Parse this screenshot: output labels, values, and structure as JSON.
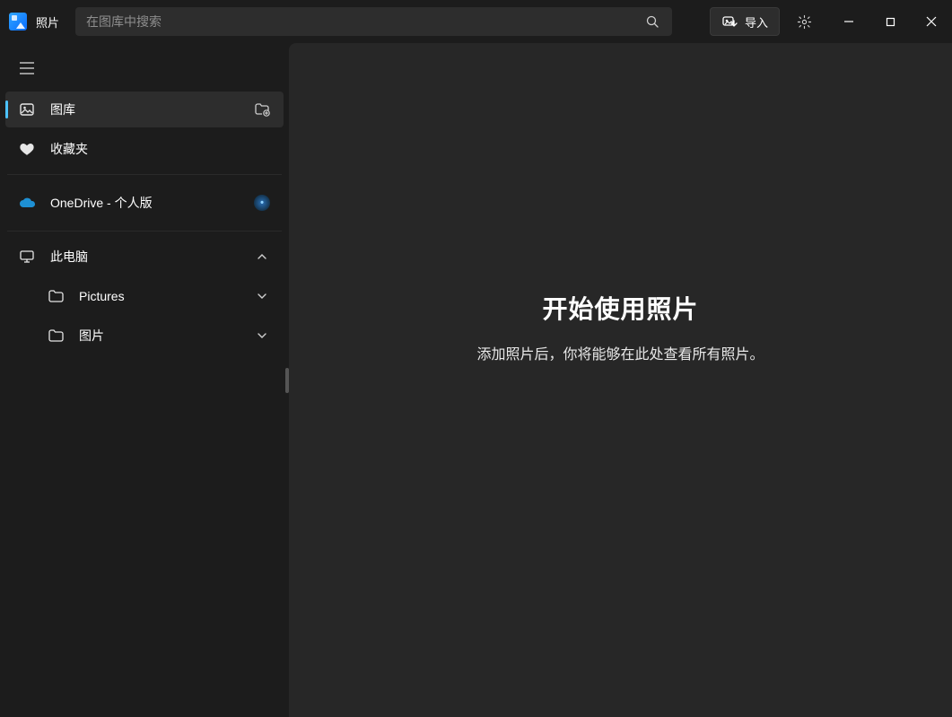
{
  "app": {
    "title": "照片"
  },
  "search": {
    "placeholder": "在图库中搜索"
  },
  "toolbar": {
    "import_label": "导入"
  },
  "sidebar": {
    "gallery_label": "图库",
    "favorites_label": "收藏夹",
    "onedrive_label": "OneDrive - 个人版",
    "thispc_label": "此电脑",
    "pictures_label": "Pictures",
    "pictures_cn_label": "图片"
  },
  "empty": {
    "title": "开始使用照片",
    "subtitle": "添加照片后，你将能够在此处查看所有照片。"
  }
}
